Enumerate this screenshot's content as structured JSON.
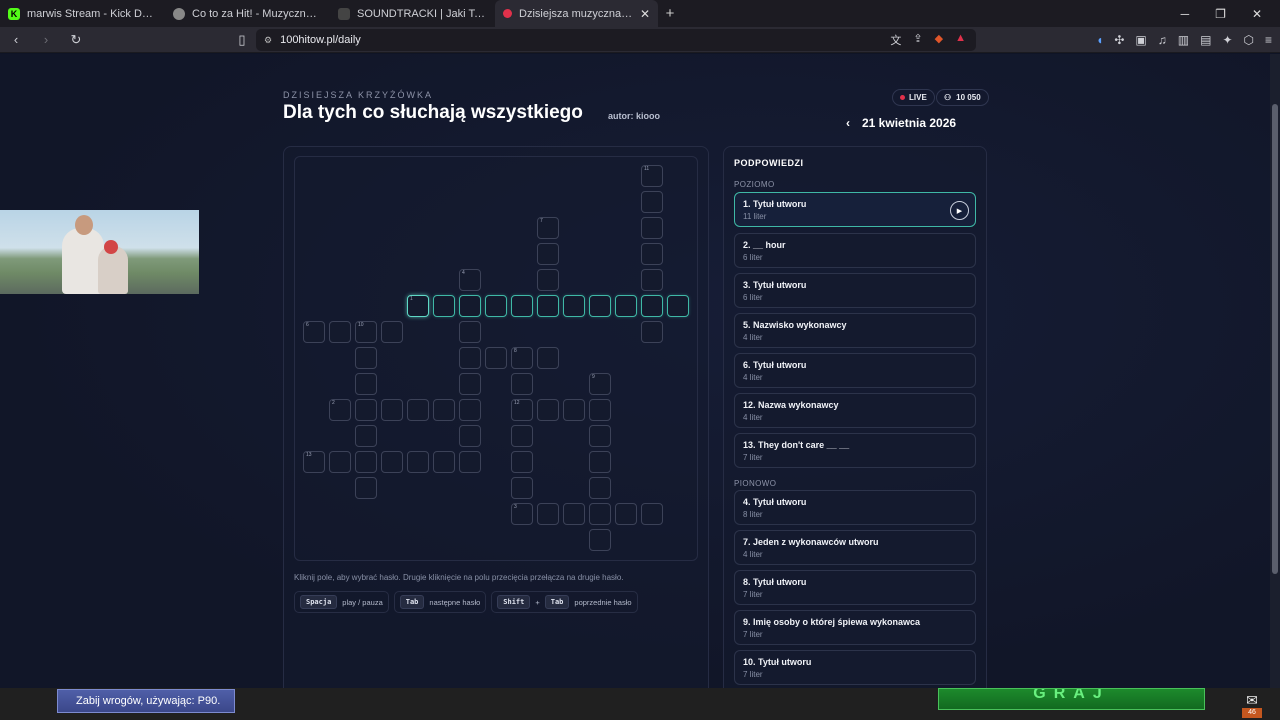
{
  "browser": {
    "tabs": [
      {
        "title": "marwis Stream - Kick Dashboard",
        "icon": "kick-icon",
        "active": false
      },
      {
        "title": "Co to za Hit! - Muzyczny Quiz Hip-H",
        "icon": "site-icon",
        "active": false
      },
      {
        "title": "SOUNDTRACKI | Jaki To Wers",
        "icon": "site-icon",
        "active": false
      },
      {
        "title": "Dzisiejsza muzyczna krzyżówka |",
        "icon": "site-icon",
        "active": true
      }
    ],
    "url": "100hitow.pl/daily"
  },
  "header": {
    "kicker": "DZISIEJSZA KRZYŻÓWKA",
    "title": "Dla tych co słuchają wszystkiego",
    "author": "autor: kiooo",
    "live_label": "LIVE",
    "player_count": "10 050",
    "date": "21 kwietnia 2026"
  },
  "grid": {
    "numbers": [
      "1",
      "2",
      "3",
      "4",
      "5",
      "6",
      "7",
      "8",
      "9",
      "10",
      "11",
      "12",
      "13"
    ]
  },
  "help": {
    "hint": "Kliknij pole, aby wybrać hasło. Drugie kliknięcie na polu przecięcia przełącza na drugie hasło.",
    "shortcuts": [
      {
        "keys": [
          "Spacja"
        ],
        "label": "play / pauza"
      },
      {
        "keys": [
          "Tab"
        ],
        "label": "następne hasło"
      },
      {
        "keys": [
          "Shift",
          "Tab"
        ],
        "label": "poprzednie hasło"
      }
    ]
  },
  "clues": {
    "heading": "PODPOWIEDZI",
    "across_label": "POZIOMO",
    "down_label": "PIONOWO",
    "across": [
      {
        "text": "1. Tytuł utworu",
        "len": "11 liter"
      },
      {
        "text": "2. __ hour",
        "len": "6 liter"
      },
      {
        "text": "3. Tytuł utworu",
        "len": "6 liter"
      },
      {
        "text": "5. Nazwisko wykonawcy",
        "len": "4 liter"
      },
      {
        "text": "6. Tytuł utworu",
        "len": "4 liter"
      },
      {
        "text": "12. Nazwa wykonawcy",
        "len": "4 liter"
      },
      {
        "text": "13. They don't care __ __",
        "len": "7 liter"
      }
    ],
    "down": [
      {
        "text": "4. Tytuł utworu",
        "len": "8 liter"
      },
      {
        "text": "7. Jeden z wykonawców utworu",
        "len": "4 liter"
      },
      {
        "text": "8. Tytuł utworu",
        "len": "7 liter"
      },
      {
        "text": "9. Imię osoby o której śpiewa wykonawca",
        "len": "7 liter"
      },
      {
        "text": "10. Tytuł utworu",
        "len": "7 liter"
      }
    ]
  },
  "overlay": {
    "stream_caption": "Zabij wrogów, używając: P90.",
    "graj_label": "GRAJ",
    "mail_count": "46"
  }
}
